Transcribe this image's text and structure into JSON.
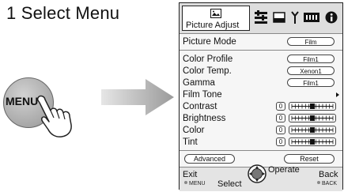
{
  "step": {
    "title": "1  Select Menu"
  },
  "remote": {
    "menu_label": "MENU"
  },
  "osd": {
    "active_tab": {
      "label": "Picture Adjust",
      "icon": "picture-icon"
    },
    "other_tabs": [
      {
        "icon": "settings-sliders-icon"
      },
      {
        "icon": "screen-icon"
      },
      {
        "icon": "antenna-icon"
      },
      {
        "icon": "battery-icon"
      },
      {
        "icon": "info-icon"
      }
    ],
    "picture_mode": {
      "label": "Picture Mode",
      "value": "Film"
    },
    "rows": [
      {
        "label": "Color Profile",
        "value": "Film1"
      },
      {
        "label": "Color Temp.",
        "value": "Xenon1"
      },
      {
        "label": "Gamma",
        "value": "Film1"
      },
      {
        "label": "Film Tone",
        "value": ""
      }
    ],
    "sliders": [
      {
        "label": "Contrast",
        "value": "0"
      },
      {
        "label": "Brightness",
        "value": "0"
      },
      {
        "label": "Color",
        "value": "0"
      },
      {
        "label": "Tint",
        "value": "0"
      }
    ],
    "buttons": {
      "advanced": "Advanced",
      "reset": "Reset"
    },
    "footer": {
      "exit": "Exit",
      "menu": "MENU",
      "select": "Select",
      "operate": "Operate",
      "back": "Back",
      "back_small": "BACK"
    }
  }
}
